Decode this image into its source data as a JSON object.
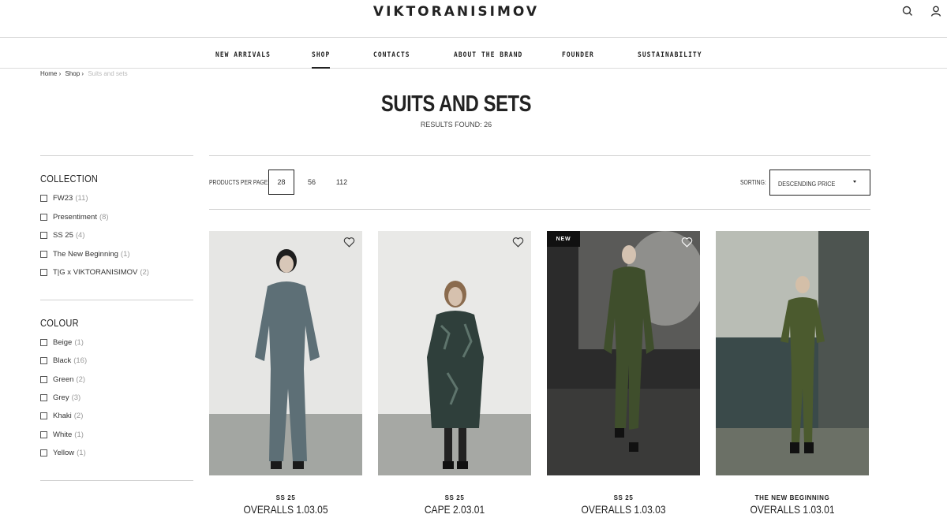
{
  "header": {
    "logo": "VIKTORANISIMOV",
    "search_icon": "search-icon",
    "account_icon": "user-icon"
  },
  "nav": {
    "items": [
      "NEW ARRIVALS",
      "SHOP",
      "CONTACTS",
      "ABOUT THE BRAND",
      "FOUNDER",
      "SUSTAINABILITY"
    ],
    "active": "SHOP"
  },
  "breadcrumb": {
    "home": "Home",
    "shop": "Shop",
    "current": "Suits and sets",
    "separator": "›"
  },
  "page": {
    "title": "SUITS AND SETS",
    "results": "RESULTS FOUND: 26"
  },
  "sidebar": {
    "collection": {
      "heading": "COLLECTION",
      "items": [
        {
          "label": "FW23",
          "count": "(11)"
        },
        {
          "label": "Presentiment",
          "count": "(8)"
        },
        {
          "label": "SS 25",
          "count": "(4)"
        },
        {
          "label": "The New Beginning",
          "count": "(1)"
        },
        {
          "label": "T|G x VIKTORANISIMOV",
          "count": "(2)"
        }
      ]
    },
    "colour": {
      "heading": "COLOUR",
      "items": [
        {
          "label": "Beige",
          "count": "(1)"
        },
        {
          "label": "Black",
          "count": "(16)"
        },
        {
          "label": "Green",
          "count": "(2)"
        },
        {
          "label": "Grey",
          "count": "(3)"
        },
        {
          "label": "Khaki",
          "count": "(2)"
        },
        {
          "label": "White",
          "count": "(1)"
        },
        {
          "label": "Yellow",
          "count": "(1)"
        }
      ]
    }
  },
  "toolbar": {
    "per_page_label": "PRODUCTS PER PAGE:",
    "per_page_options": [
      "28",
      "56",
      "112"
    ],
    "per_page_selected": "28",
    "sorting_label": "SORTING:",
    "sorting_value": "DESCENDING PRICE"
  },
  "products": [
    {
      "collection": "SS 25",
      "name": "OVERALLS 1.03.05",
      "badge": "",
      "colors": {
        "bg": "#e6e6e4",
        "floor": "#a3a6a2",
        "garment": "#5d6f76"
      }
    },
    {
      "collection": "SS 25",
      "name": "CAPE 2.03.01",
      "badge": "",
      "colors": {
        "bg": "#e9e9e7",
        "floor": "#a6a8a4",
        "garment": "#2f3f3b"
      }
    },
    {
      "collection": "SS 25",
      "name": "OVERALLS 1.03.03",
      "badge": "NEW",
      "colors": {
        "bg": "#2b2b2b",
        "floor": "#5a5a58",
        "garment": "#3f4e2c"
      }
    },
    {
      "collection": "THE NEW BEGINNING",
      "name": "OVERALLS 1.03.01",
      "badge": "",
      "colors": {
        "bg": "#b9bdb5",
        "floor": "#6b7066",
        "garment": "#4b5a2e"
      }
    }
  ]
}
